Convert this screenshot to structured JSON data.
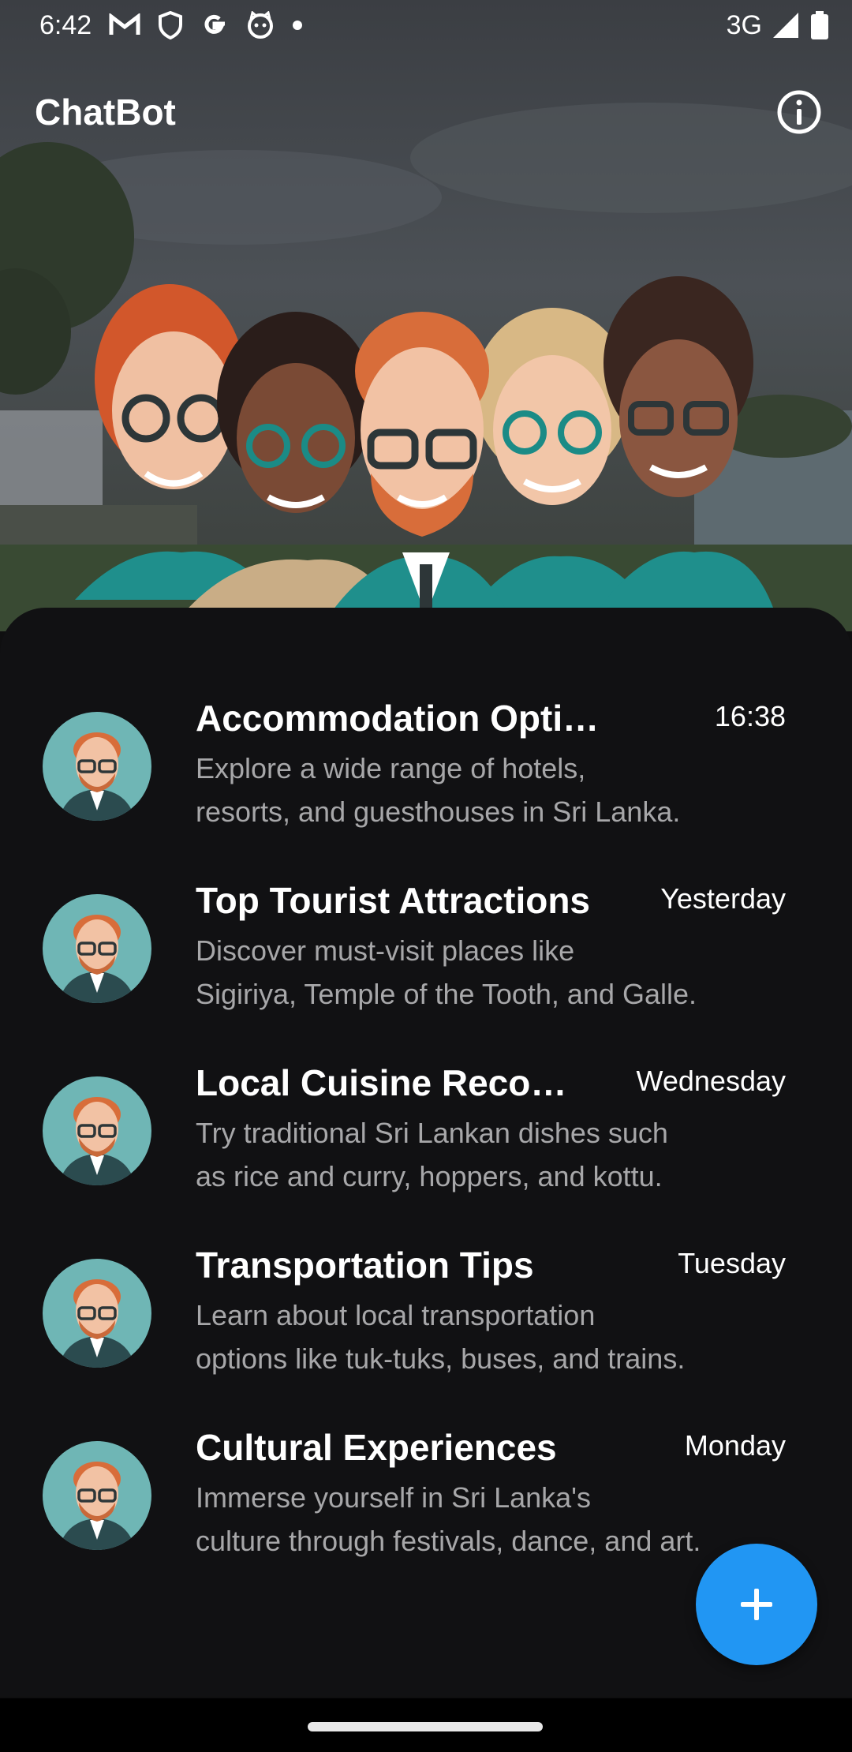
{
  "status_bar": {
    "time": "6:42",
    "network": "3G",
    "notification_icons": [
      "gmail-icon",
      "shield-icon",
      "google-icon",
      "cat-face-icon",
      "dot-icon"
    ]
  },
  "app_bar": {
    "title": "ChatBot",
    "info_icon": "info-icon"
  },
  "colors": {
    "accent": "#2196f3",
    "sheet_background": "#111113",
    "subtitle_text": "#a7a7a9",
    "avatar_background": "#6fb6b5"
  },
  "conversations": [
    {
      "title": "Accommodation Options",
      "time": "16:38",
      "preview_line1": "Explore a wide range of hotels,",
      "preview_line2": "resorts, and guesthouses in Sri Lanka."
    },
    {
      "title": "Top Tourist Attractions",
      "time": "Yesterday",
      "preview_line1": "Discover must-visit places like",
      "preview_line2": "Sigiriya, Temple of the Tooth, and Galle."
    },
    {
      "title": "Local Cuisine Recommendations",
      "time": "Wednesday",
      "preview_line1": "Try traditional Sri Lankan dishes such",
      "preview_line2": "as rice and curry, hoppers, and kottu."
    },
    {
      "title": "Transportation Tips",
      "time": "Tuesday",
      "preview_line1": "Learn about local transportation",
      "preview_line2": "options like tuk-tuks, buses, and trains."
    },
    {
      "title": "Cultural Experiences",
      "time": "Monday",
      "preview_line1": "Immerse yourself in Sri Lanka's",
      "preview_line2": "culture through festivals, dance, and art."
    }
  ],
  "fab": {
    "icon": "plus-icon"
  }
}
